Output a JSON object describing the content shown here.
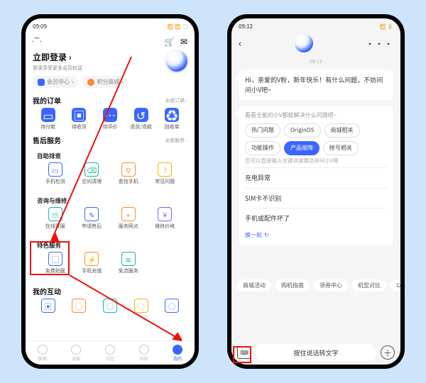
{
  "left": {
    "status_time": "09:09",
    "login_title": "立即登录",
    "login_arrow": "›",
    "login_sub": "登录享受更多会员权益",
    "pill_member": "会员中心",
    "pill_points": "积分商城",
    "orders": {
      "title": "我的订单",
      "more": "全部订单 ›",
      "items": [
        "待付款",
        "待收货",
        "待评价",
        "退货/退款",
        "回收单"
      ]
    },
    "aftersale_title": "售后服务",
    "aftersale_more": "全部服务 ›",
    "group1_title": "自助排查",
    "group1_items": [
      "手机检测",
      "空间清理",
      "查找手机",
      "常见问题"
    ],
    "group2_title": "咨询与维修",
    "group2_items": [
      "在线客服",
      "申请售后",
      "服务网点",
      "维修价格"
    ],
    "group3_title": "特色服务",
    "group3_items": [
      "免费贴膜",
      "手机充值",
      "免流服务"
    ],
    "interact_title": "我的互动",
    "nav": [
      "推荐",
      "选购",
      "社区",
      "体验",
      "我的"
    ]
  },
  "right": {
    "status_time": "09:12",
    "chat_time": "09:11",
    "greeting": "Hi，亲爱的V粉，新年快乐！有什么问题，不妨问问小V吧~",
    "help_title": "看看全能的小V都能解决什么问题吧~",
    "chips": [
      "热门问题",
      "OriginOS",
      "商城相关",
      "功能操作",
      "产品故障",
      "帐号相关"
    ],
    "active_chip_index": 4,
    "sugg_title": "您可以直接输入关键词或像这样问小V哦",
    "sugg_items": [
      "充电异常",
      "SIM卡不识别",
      "手机或配件坏了"
    ],
    "refresh": "换一批",
    "quick": [
      "商城活动",
      "购机指南",
      "领券中心",
      "机型对比",
      "以"
    ],
    "input_placeholder": "按住说话转文字"
  }
}
